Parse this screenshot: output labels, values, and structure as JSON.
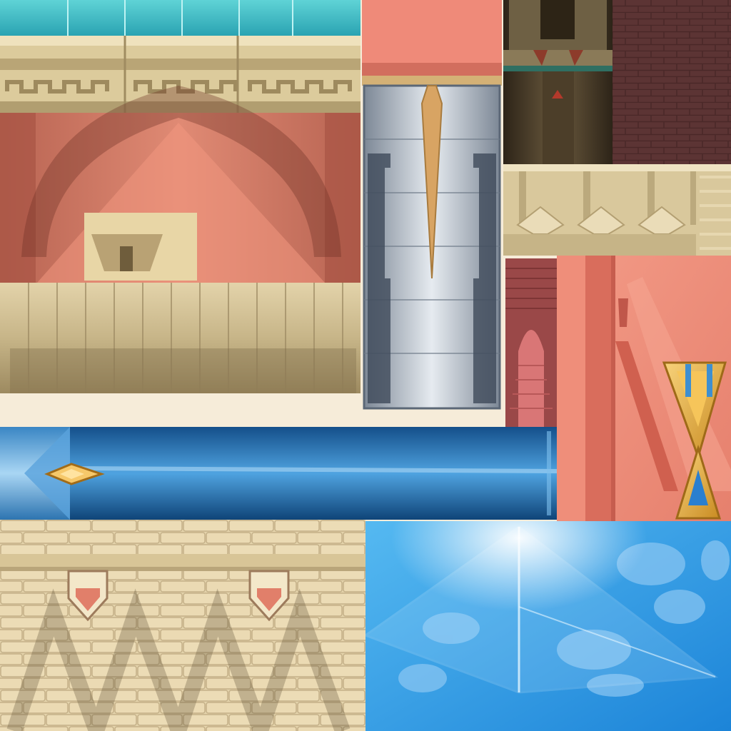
{
  "atlas": {
    "palette": {
      "sand": "#e4d2a6",
      "sand_dark": "#a89467",
      "terracotta": "#d87a66",
      "salmon": "#f2937e",
      "crimson": "#9a4545",
      "teal": "#35c0c8",
      "steel": "#9aa6b4",
      "royal_blue": "#1f66a8",
      "sky_blue": "#2f9ae6",
      "gold": "#e0a53a",
      "brown": "#4a3a28",
      "brick": "#5a3232"
    },
    "tiles": [
      "temple-facade-tile",
      "stone-pillar-tile",
      "dark-doorway-tile",
      "brick-wall-tile",
      "sand-frieze-tile",
      "stair-arch-tile",
      "pink-pillar-ornament-tile",
      "blue-beam-tile",
      "sandstone-wall-tile",
      "glass-pyramid-tile"
    ]
  }
}
